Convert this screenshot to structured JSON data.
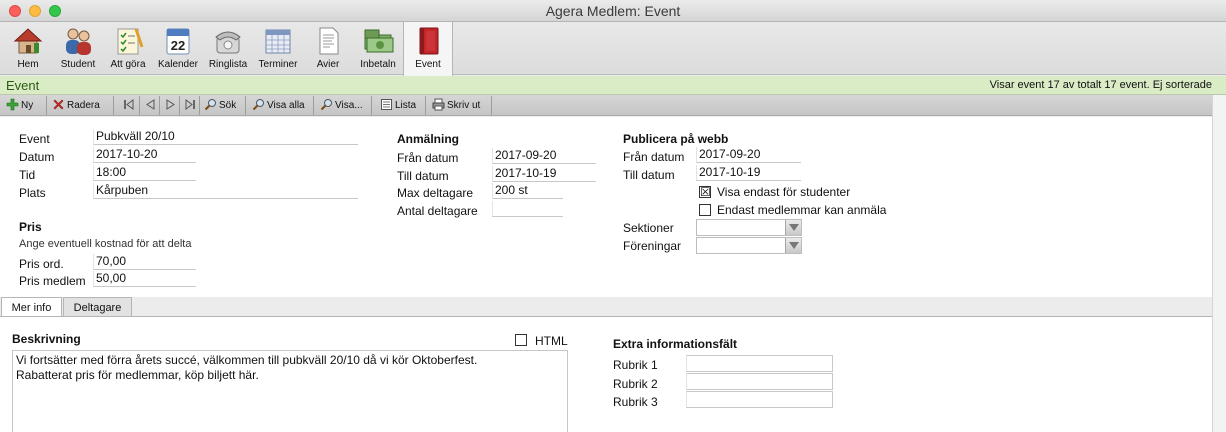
{
  "window": {
    "title": "Agera Medlem: Event"
  },
  "toolbar": {
    "items": [
      {
        "label": "Hem",
        "icon": "house-icon"
      },
      {
        "label": "Student",
        "icon": "users-icon"
      },
      {
        "label": "Att göra",
        "icon": "checklist-icon"
      },
      {
        "label": "Kalender",
        "icon": "calendar-icon",
        "day": "22"
      },
      {
        "label": "Ringlista",
        "icon": "phone-icon"
      },
      {
        "label": "Terminer",
        "icon": "grid-icon"
      },
      {
        "label": "Avier",
        "icon": "document-icon"
      },
      {
        "label": "Inbetaln",
        "icon": "money-icon"
      },
      {
        "label": "Event",
        "icon": "book-icon"
      }
    ]
  },
  "section": {
    "title": "Event",
    "status": "Visar event 17 av totalt 17 event. Ej sorterade"
  },
  "actions": {
    "new": "Ny",
    "delete": "Radera",
    "search": "Sök",
    "show_all": "Visa alla",
    "show": "Visa...",
    "list": "Lista",
    "print": "Skriv ut"
  },
  "event": {
    "event_label": "Event",
    "event_value": "Pubkväll 20/10",
    "date_label": "Datum",
    "date_value": "2017-10-20",
    "time_label": "Tid",
    "time_value": "18:00",
    "place_label": "Plats",
    "place_value": "Kårpuben"
  },
  "price": {
    "heading": "Pris",
    "hint": "Ange eventuell kostnad för att delta",
    "ord_label": "Pris ord.",
    "ord_value": "70,00",
    "member_label": "Pris medlem",
    "member_value": "50,00"
  },
  "registration": {
    "heading": "Anmälning",
    "from_label": "Från datum",
    "from_value": "2017-09-20",
    "to_label": "Till datum",
    "to_value": "2017-10-19",
    "max_label": "Max deltagare",
    "max_value": "200 st",
    "count_label": "Antal deltagare",
    "count_value": ""
  },
  "publish": {
    "heading": "Publicera på webb",
    "from_label": "Från datum",
    "from_value": "2017-09-20",
    "to_label": "Till datum",
    "to_value": "2017-10-19",
    "students_only_label": "Visa endast för studenter",
    "students_only_mark": "☒",
    "members_only_label": "Endast medlemmar kan anmäla",
    "sections_label": "Sektioner",
    "associations_label": "Föreningar"
  },
  "tabs": {
    "more_info": "Mer info",
    "participants": "Deltagare"
  },
  "details": {
    "description_label": "Beskrivning",
    "html_label": "HTML",
    "description_text": "Vi fortsätter med förra årets succé, välkommen till pubkväll 20/10 då vi kör Oktoberfest.\nRabatterat pris för medlemmar, köp biljett här.",
    "extra_heading": "Extra informationsfält",
    "rubrik1": "Rubrik 1",
    "rubrik2": "Rubrik 2",
    "rubrik3": "Rubrik 3"
  }
}
